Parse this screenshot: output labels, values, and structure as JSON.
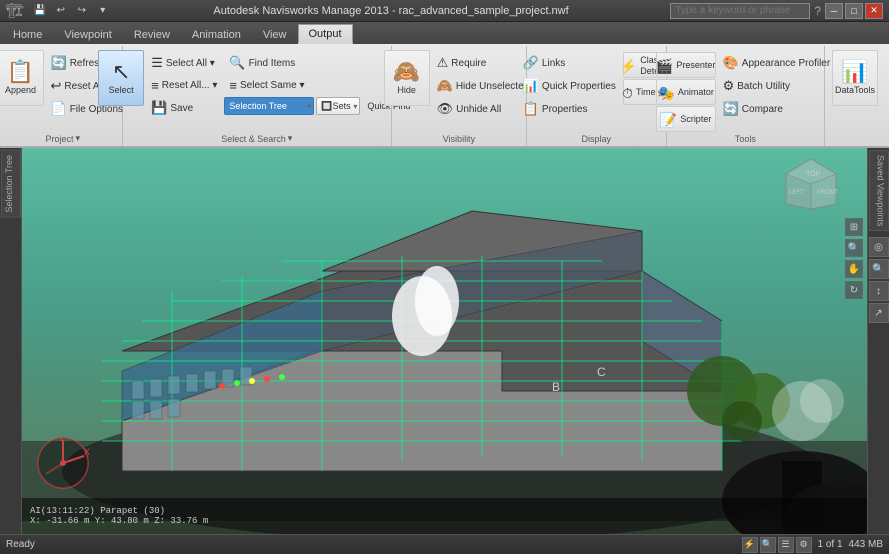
{
  "titlebar": {
    "title": "Autodesk Navisworks Manage 2013  -  rac_advanced_sample_project.nwf",
    "search_placeholder": "Type a keyword or phrase",
    "min_btn": "─",
    "max_btn": "□",
    "close_btn": "✕"
  },
  "ribbon": {
    "tabs": [
      {
        "label": "Home",
        "active": true
      },
      {
        "label": "Viewpoint",
        "active": false
      },
      {
        "label": "Review",
        "active": false
      },
      {
        "label": "Animation",
        "active": false
      },
      {
        "label": "View",
        "active": false
      },
      {
        "label": "Output",
        "active": false
      },
      {
        "label": "Output",
        "active": false
      }
    ],
    "groups": [
      {
        "label": "Project",
        "items": [
          {
            "type": "large",
            "icon": "📋",
            "label": "Append",
            "name": "append-btn"
          },
          {
            "type": "small-col",
            "buttons": [
              {
                "icon": "🔄",
                "label": "Refresh",
                "name": "refresh-btn"
              },
              {
                "icon": "↩",
                "label": "Reset All...",
                "name": "reset-all-btn"
              },
              {
                "icon": "📄",
                "label": "File Options",
                "name": "file-options-btn"
              }
            ]
          }
        ]
      },
      {
        "label": "Select & Search",
        "items": [
          {
            "type": "large",
            "icon": "⬆",
            "label": "Select",
            "name": "select-btn"
          },
          {
            "type": "small-col",
            "buttons": [
              {
                "icon": "☰",
                "label": "Select All ▾",
                "name": "select-all-btn"
              },
              {
                "icon": "≡",
                "label": "Reset All... ▾",
                "name": "reset-all2-btn"
              },
              {
                "icon": "💾",
                "label": "Save Selection",
                "name": "save-selection-btn"
              }
            ]
          },
          {
            "type": "small-col",
            "buttons": [
              {
                "icon": "🔍",
                "label": "Find Items",
                "name": "find-items-btn"
              },
              {
                "icon": "≡",
                "label": "Select Same ▾",
                "name": "select-same-btn"
              }
            ]
          },
          {
            "type": "dropdown-row",
            "buttons": [
              {
                "label": "Selection Tree",
                "name": "selection-tree-dropdown"
              },
              {
                "label": "Sets ▾",
                "name": "sets-dropdown"
              },
              {
                "icon": "⚡",
                "label": "Quick Find",
                "name": "quick-find-btn"
              }
            ]
          }
        ]
      },
      {
        "label": "Visibility",
        "items": [
          {
            "type": "large",
            "icon": "🙈",
            "label": "Hide",
            "name": "hide-btn"
          },
          {
            "type": "small-col",
            "buttons": [
              {
                "icon": "👁",
                "label": "Require",
                "name": "require-btn"
              },
              {
                "icon": "🙈",
                "label": "Hide Unselected",
                "name": "hide-unselected-btn"
              },
              {
                "icon": "👁",
                "label": "Unhide All",
                "name": "unhide-all-btn"
              }
            ]
          }
        ]
      },
      {
        "label": "Display",
        "items": [
          {
            "type": "small-col",
            "buttons": [
              {
                "icon": "🔗",
                "label": "Links",
                "name": "links-btn"
              },
              {
                "icon": "📊",
                "label": "Quick Properties",
                "name": "quick-properties-btn"
              },
              {
                "icon": "📋",
                "label": "Properties",
                "name": "properties-btn"
              }
            ]
          },
          {
            "type": "large-col",
            "buttons": [
              {
                "icon": "⚡",
                "label": "Clash Detective",
                "name": "clash-detective-btn"
              },
              {
                "icon": "⏱",
                "label": "TimeLiner",
                "name": "timeliner-btn"
              }
            ]
          }
        ]
      },
      {
        "label": "Tools",
        "items": [
          {
            "type": "large",
            "icon": "🎬",
            "label": "Presenter",
            "name": "presenter-btn"
          },
          {
            "type": "large",
            "icon": "🎭",
            "label": "Animator",
            "name": "animator-btn"
          },
          {
            "type": "large",
            "icon": "📝",
            "label": "Scripter",
            "name": "scripter-btn"
          },
          {
            "type": "small-col",
            "buttons": [
              {
                "icon": "🎨",
                "label": "Appearance Profiler",
                "name": "appearance-profiler-btn"
              },
              {
                "icon": "⚙",
                "label": "Batch Utility",
                "name": "batch-utility-btn"
              },
              {
                "icon": "🔄",
                "label": "Compare",
                "name": "compare-btn"
              }
            ]
          }
        ]
      },
      {
        "label": "",
        "items": [
          {
            "type": "large",
            "icon": "📊",
            "label": "DataTools",
            "name": "datatools-btn"
          }
        ]
      }
    ]
  },
  "viewport": {
    "coord_line1": "AI(13:11:22)  Parapet (30)",
    "coord_line2": "X: -31.66 m  Y: 43.80 m  Z: 33.76 m"
  },
  "left_panel": {
    "label": "Selection Tree"
  },
  "right_panel": {
    "label": "Saved Viewpoints",
    "nav_btns": [
      "⊕",
      "🔍",
      "↕",
      "🔃"
    ]
  },
  "status_bar": {
    "status": "Ready",
    "page_info": "1 of 1",
    "file_size": "443 MB"
  }
}
